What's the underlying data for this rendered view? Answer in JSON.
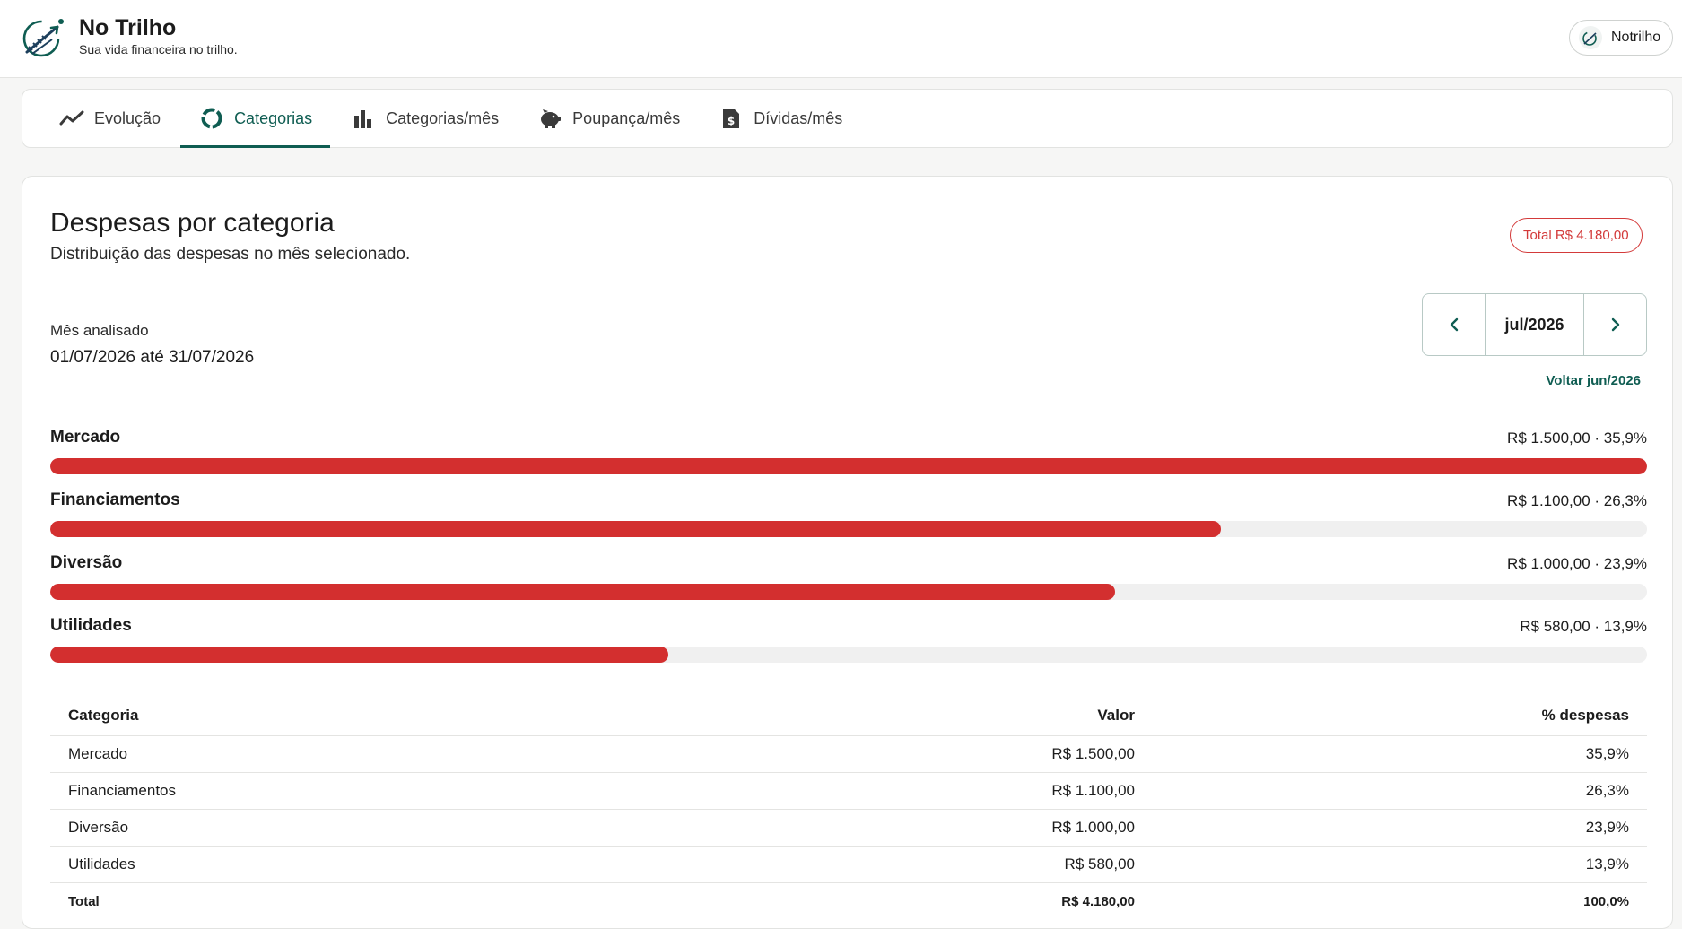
{
  "app": {
    "name": "No Trilho",
    "tagline": "Sua vida financeira no trilho.",
    "user": "Notrilho",
    "accent": "#0f5d52",
    "danger": "#d32f2f"
  },
  "tabs": [
    {
      "label": "Evolução",
      "icon": "trend-line-icon",
      "active": false
    },
    {
      "label": "Categorias",
      "icon": "donut-chart-icon",
      "active": true
    },
    {
      "label": "Categorias/mês",
      "icon": "bar-chart-icon",
      "active": false
    },
    {
      "label": "Poupança/mês",
      "icon": "piggy-bank-icon",
      "active": false
    },
    {
      "label": "Dívidas/mês",
      "icon": "invoice-icon",
      "active": false
    }
  ],
  "report": {
    "title": "Despesas por categoria",
    "subtitle": "Distribuição das despesas no mês selecionado.",
    "total_badge": "Total R$ 4.180,00",
    "period_label": "Mês analisado",
    "period_range": "01/07/2026 até 31/07/2026",
    "month": "jul/2026",
    "back_link": "Voltar jun/2026"
  },
  "categories": [
    {
      "name": "Mercado",
      "value_text": "R$ 1.500,00 · 35,9%",
      "share": 1.0
    },
    {
      "name": "Financiamentos",
      "value_text": "R$ 1.100,00 · 26,3%",
      "share": 0.733
    },
    {
      "name": "Diversão",
      "value_text": "R$ 1.000,00 · 23,9%",
      "share": 0.667
    },
    {
      "name": "Utilidades",
      "value_text": "R$ 580,00 · 13,9%",
      "share": 0.387
    }
  ],
  "table": {
    "headers": [
      "Categoria",
      "Valor",
      "% despesas"
    ],
    "rows": [
      [
        "Mercado",
        "R$ 1.500,00",
        "35,9%"
      ],
      [
        "Financiamentos",
        "R$ 1.100,00",
        "26,3%"
      ],
      [
        "Diversão",
        "R$ 1.000,00",
        "23,9%"
      ],
      [
        "Utilidades",
        "R$ 580,00",
        "13,9%"
      ]
    ],
    "total": [
      "Total",
      "R$ 4.180,00",
      "100,0%"
    ]
  }
}
